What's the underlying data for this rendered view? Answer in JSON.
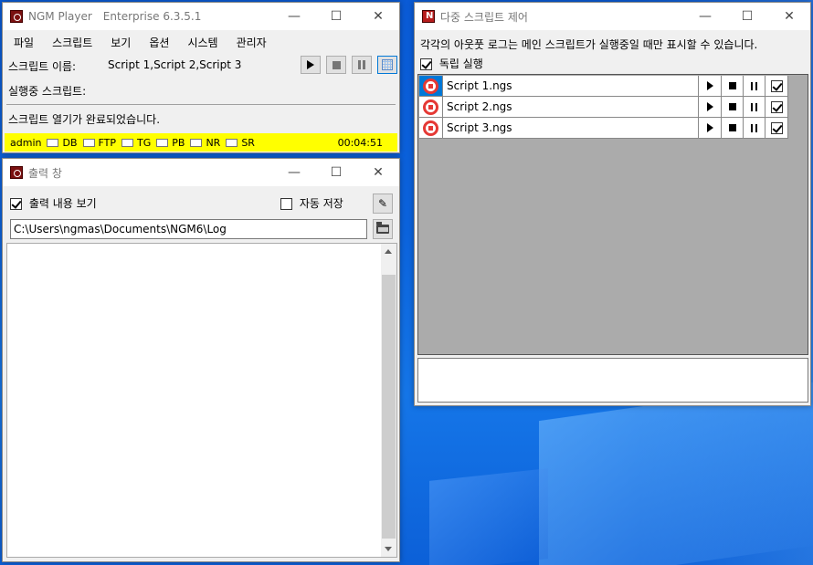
{
  "player": {
    "title": "NGM Player",
    "edition": "Enterprise 6.3.5.1",
    "menu": [
      "파일",
      "스크립트",
      "보기",
      "옵션",
      "시스템",
      "관리자"
    ],
    "script_name_label": "스크립트 이름:",
    "script_name_value": "Script 1,Script 2,Script 3",
    "running_label": "실행중 스크립트:",
    "status_message": "스크립트 열기가 완료되었습니다.",
    "statusbar": {
      "user": "admin",
      "indicators": [
        "DB",
        "FTP",
        "TG",
        "PB",
        "NR",
        "SR"
      ],
      "elapsed": "00:04:51"
    }
  },
  "output": {
    "title": "출력 창",
    "show_output_label": "출력 내용 보기",
    "show_output_checked": true,
    "auto_save_label": "자동 저장",
    "auto_save_checked": false,
    "path": "C:\\Users\\ngmas\\Documents\\NGM6\\Log"
  },
  "multi": {
    "title": "다중 스크립트 제어",
    "description": "각각의 아웃풋 로그는 메인 스크립트가 실행중일 때만 표시할 수 있습니다.",
    "independent_label": "독립 실행",
    "independent_checked": true,
    "scripts": [
      {
        "name": "Script 1.ngs",
        "checked": true
      },
      {
        "name": "Script 2.ngs",
        "checked": true
      },
      {
        "name": "Script 3.ngs",
        "checked": true
      }
    ]
  },
  "colors": {
    "statusbar": "#ffff00",
    "stop_icon": "#e53935",
    "selection": "#0078d7"
  }
}
